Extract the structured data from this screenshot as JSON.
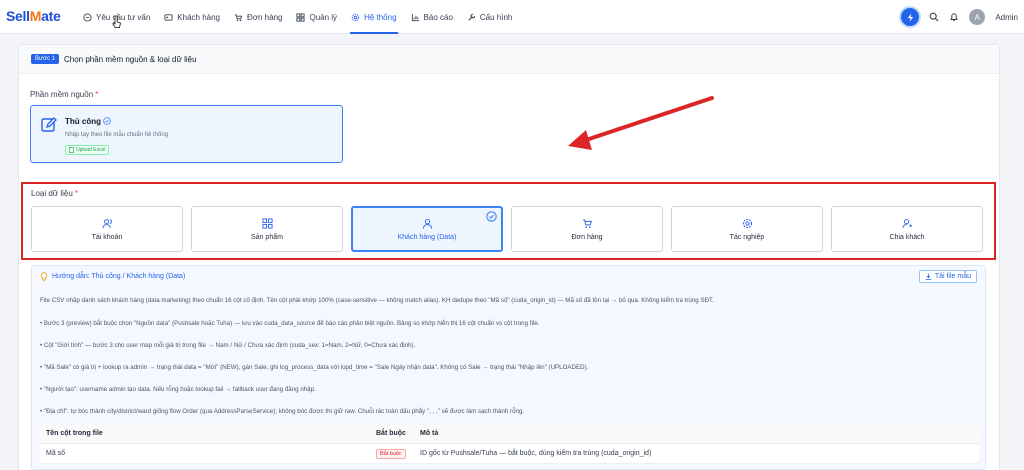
{
  "brand": {
    "prefix": "Sell",
    "mark": "M",
    "suffix": "ate"
  },
  "nav": {
    "items": [
      {
        "label": "Yêu cầu tư vấn",
        "icon": "clock-icon"
      },
      {
        "label": "Khách hàng",
        "icon": "id-card-icon"
      },
      {
        "label": "Đơn hàng",
        "icon": "cart-icon"
      },
      {
        "label": "Quản lý",
        "icon": "grid-icon"
      },
      {
        "label": "Hệ thống",
        "icon": "gear-icon",
        "active": true
      },
      {
        "label": "Báo cáo",
        "icon": "chart-icon"
      },
      {
        "label": "Cấu hình",
        "icon": "wrench-icon"
      }
    ]
  },
  "user": {
    "initial": "A",
    "name": "Admin"
  },
  "step": {
    "badge": "Bước 1",
    "title": "Chọn phần mềm nguồn & loại dữ liệu"
  },
  "source": {
    "label": "Phần mềm nguồn",
    "card_title": "Thủ công",
    "card_desc": "Nhập tay theo file mẫu chuẩn hệ thống",
    "tag": "Upload Excel"
  },
  "data_type": {
    "label": "Loại dữ liệu",
    "tiles": [
      {
        "label": "Tài khoản",
        "icon": "users-icon"
      },
      {
        "label": "Sản phẩm",
        "icon": "grid-icon"
      },
      {
        "label": "Khách hàng (Data)",
        "icon": "user-icon",
        "selected": true
      },
      {
        "label": "Đơn hàng",
        "icon": "cart-icon"
      },
      {
        "label": "Tác nghiệp",
        "icon": "gear-icon"
      },
      {
        "label": "Chia khách",
        "icon": "user-share-icon"
      }
    ]
  },
  "guide": {
    "title": "Hướng dẫn: Thủ công / Khách hàng (Data)",
    "download": "Tải file mẫu",
    "lines": [
      "File CSV nhập danh sách khách hàng (data marketing) theo chuẩn 16 cột cố định. Tên cột phải khớp 100% (case-sensitive — không match alias). KH dedupe theo \"Mã số\" (cuda_origin_id) — Mã số đã tồn tại → bỏ qua. Không kiểm tra trùng SĐT.",
      "• Bước 3 (preview) bắt buộc chọn \"Nguồn data\" (Pushsale hoặc Tuha) — lưu vào cuda_data_source để báo cáo phân biệt nguồn. Bảng so khớp hiển thị 16 cột chuẩn vs cột trong file.",
      "• Cột \"Giới tính\" — bước 3 cho user map mỗi giá trị trong file → Nam / Nữ / Chưa xác định (cuda_sex: 1=Nam, 2=Nữ, 0=Chưa xác định).",
      "• \"Mã Sale\" có giá trị + lookup ra admin → trạng thái data = \"Mới\" (NEW), gán Sale, ghi log_process_data với lopd_time = \"Sale Ngày nhận data\". Không có Sale → trạng thái \"Nhập lên\" (UPLOADED).",
      "• \"Người tạo\": username admin tạo data. Nếu rỗng hoặc lookup fail → fallback user đang đăng nhập.",
      "• \"Địa chỉ\": tự bóc thành city/district/ward giống flow Order (qua AddressParseService); không bóc được thì giữ raw. Chuỗi rác toàn dấu phẩy \", , ,\" sẽ được làm sạch thành rỗng."
    ],
    "table": {
      "headers": [
        "Tên cột trong file",
        "Bắt buộc",
        "Mô tả"
      ],
      "rows": [
        {
          "col": "Mã số",
          "required": "Bắt buộc",
          "desc": "ID gốc từ Pushsale/Tuha — bắt buộc, dùng kiểm tra trùng (cuda_origin_id)"
        }
      ]
    }
  }
}
